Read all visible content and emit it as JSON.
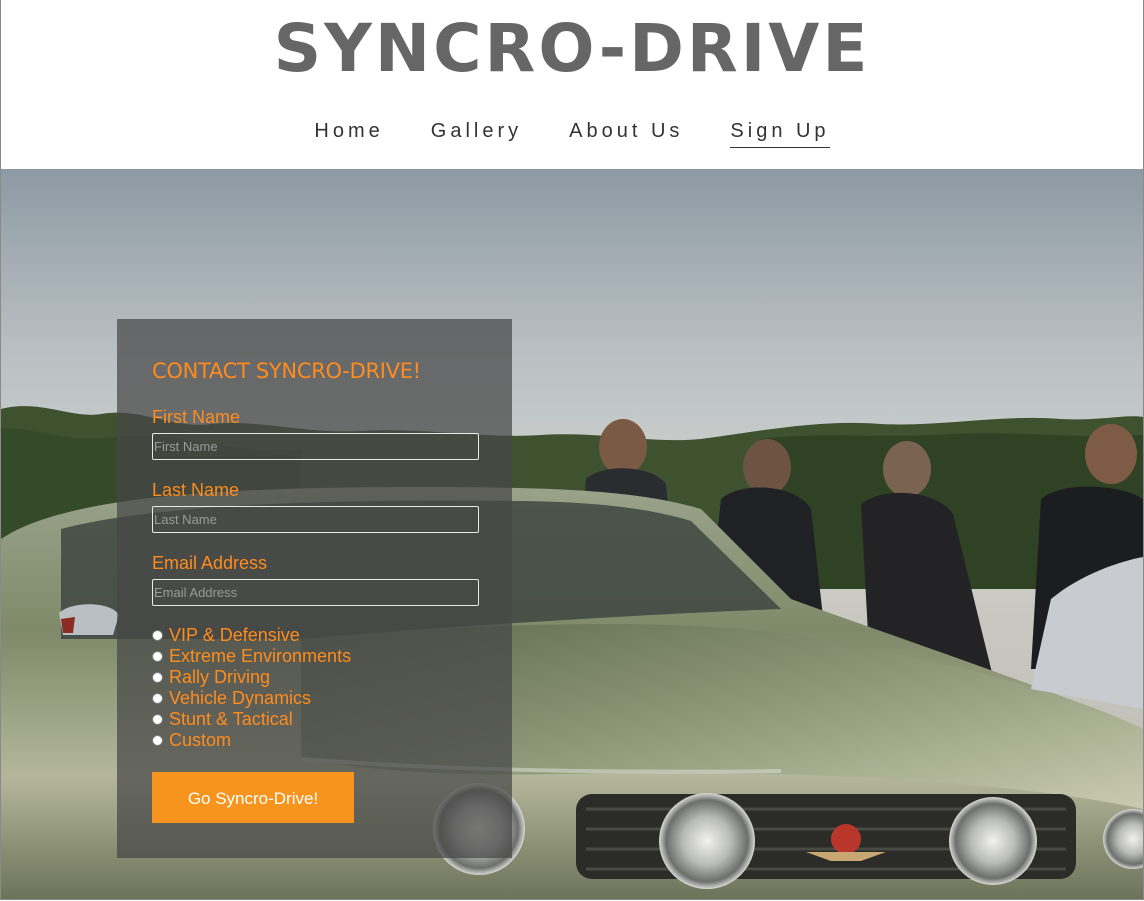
{
  "brand": {
    "title": "SYNCRO-DRIVE"
  },
  "nav": {
    "items": [
      {
        "label": "Home",
        "active": false
      },
      {
        "label": "Gallery",
        "active": false
      },
      {
        "label": "About Us",
        "active": false
      },
      {
        "label": "Sign Up",
        "active": true
      }
    ]
  },
  "form": {
    "title": "CONTACT SYNCRO-DRIVE!",
    "first_name": {
      "label": "First Name",
      "placeholder": "First Name",
      "value": ""
    },
    "last_name": {
      "label": "Last Name",
      "placeholder": "Last Name",
      "value": ""
    },
    "email": {
      "label": "Email Address",
      "placeholder": "Email Address",
      "value": ""
    },
    "options": [
      {
        "label": "VIP & Defensive",
        "checked": false
      },
      {
        "label": "Extreme Environments",
        "checked": false
      },
      {
        "label": "Rally Driving",
        "checked": false
      },
      {
        "label": "Vehicle Dynamics",
        "checked": false
      },
      {
        "label": "Stunt & Tactical",
        "checked": false
      },
      {
        "label": "Custom",
        "checked": false
      }
    ],
    "submit_label": "Go Syncro-Drive!"
  },
  "colors": {
    "accent": "#f7941d",
    "accent_text": "#ff8c1e",
    "brand_text": "#666666",
    "nav_text": "#333333",
    "panel_bg": "#464646"
  }
}
